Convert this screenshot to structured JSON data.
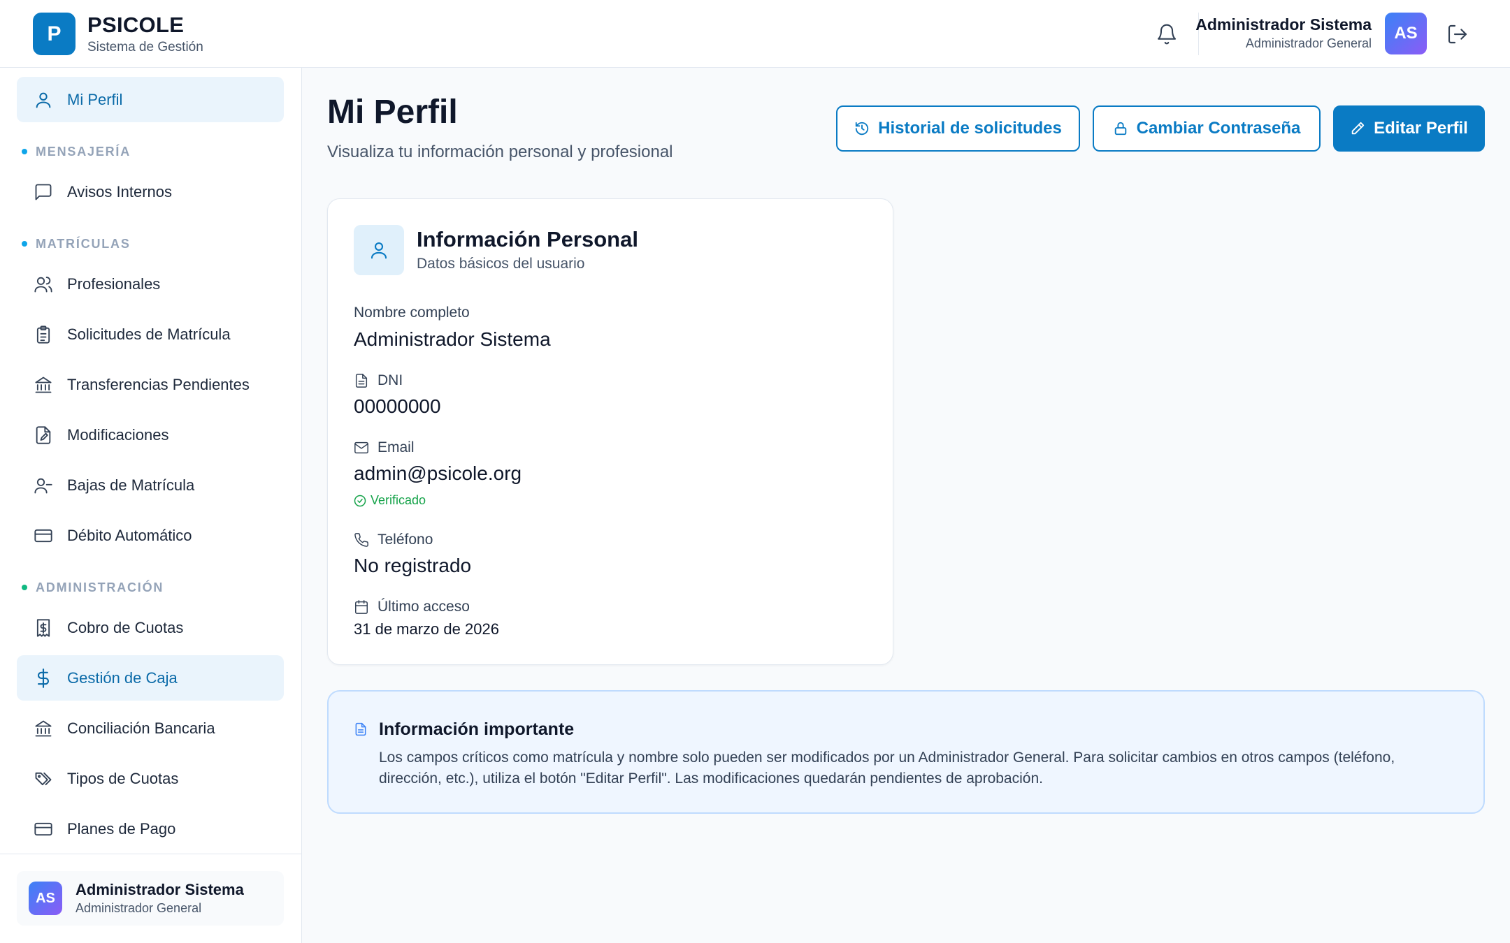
{
  "brand": {
    "logo_letter": "P",
    "name": "PSICOLE",
    "subtitle": "Sistema de Gestión"
  },
  "header": {
    "user_name": "Administrador Sistema",
    "user_role": "Administrador General",
    "avatar_initials": "AS",
    "icons": [
      "bell-icon",
      "logout-icon"
    ]
  },
  "sidebar": {
    "top_item": {
      "label": "Mi Perfil",
      "icon": "user-icon",
      "active": true
    },
    "sections": [
      {
        "label": "MENSAJERÍA",
        "dot_color": "#0ea5e9",
        "items": [
          {
            "label": "Avisos Internos",
            "icon": "message-square-icon"
          }
        ]
      },
      {
        "label": "MATRÍCULAS",
        "dot_color": "#0ea5e9",
        "items": [
          {
            "label": "Profesionales",
            "icon": "users-icon"
          },
          {
            "label": "Solicitudes de Matrícula",
            "icon": "clipboard-list-icon"
          },
          {
            "label": "Transferencias Pendientes",
            "icon": "bank-icon"
          },
          {
            "label": "Modificaciones",
            "icon": "file-edit-icon"
          },
          {
            "label": "Bajas de Matrícula",
            "icon": "user-minus-icon"
          },
          {
            "label": "Débito Automático",
            "icon": "credit-card-icon"
          }
        ]
      },
      {
        "label": "ADMINISTRACIÓN",
        "dot_color": "#10b981",
        "items": [
          {
            "label": "Cobro de Cuotas",
            "icon": "receipt-icon"
          },
          {
            "label": "Gestión de Caja",
            "icon": "dollar-icon",
            "active": true
          },
          {
            "label": "Conciliación Bancaria",
            "icon": "bank-icon"
          },
          {
            "label": "Tipos de Cuotas",
            "icon": "tags-icon"
          },
          {
            "label": "Planes de Pago",
            "icon": "credit-card-icon"
          }
        ]
      }
    ],
    "footer_user": {
      "name": "Administrador Sistema",
      "role": "Administrador General",
      "initials": "AS"
    }
  },
  "page": {
    "title": "Mi Perfil",
    "subtitle": "Visualiza tu información personal y profesional",
    "buttons": {
      "history": "Historial de solicitudes",
      "password": "Cambiar Contraseña",
      "edit": "Editar Perfil"
    }
  },
  "personal_card": {
    "title": "Información Personal",
    "subtitle": "Datos básicos del usuario",
    "fields": {
      "full_name": {
        "label": "Nombre completo",
        "value": "Administrador Sistema"
      },
      "dni": {
        "label": "DNI",
        "value": "00000000"
      },
      "email": {
        "label": "Email",
        "value": "admin@psicole.org",
        "status": "Verificado"
      },
      "phone": {
        "label": "Teléfono",
        "value": "No registrado"
      },
      "last_access": {
        "label": "Último acceso",
        "value": "31 de marzo de 2026"
      }
    }
  },
  "notice": {
    "title": "Información importante",
    "text": "Los campos críticos como matrícula y nombre solo pueden ser modificados por un Administrador General. Para solicitar cambios en otros campos (teléfono, dirección, etc.), utiliza el botón \"Editar Perfil\". Las modificaciones quedarán pendientes de aprobación."
  },
  "colors": {
    "primary": "#0a7bc4",
    "active_bg": "#eaf4fc",
    "verified": "#16a34a",
    "notice_bg": "#eff6ff"
  }
}
